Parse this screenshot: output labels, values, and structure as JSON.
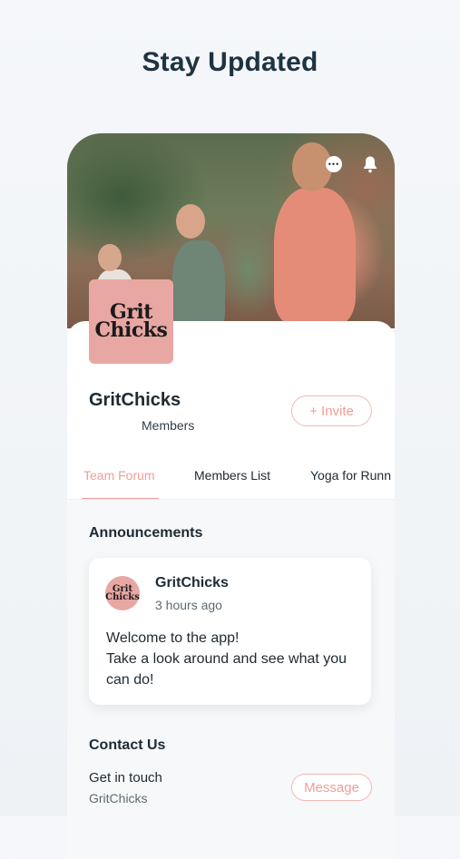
{
  "headline": "Stay Updated",
  "header_icons": {
    "chat": "chat-bubble-icon",
    "notifications": "bell-icon"
  },
  "group": {
    "logo_text_top": "Grit",
    "logo_text_bottom": "Chicks",
    "name": "GritChicks",
    "members_label": "Members",
    "invite_label": "+ Invite"
  },
  "tabs": [
    {
      "label": "Team Forum",
      "active": true
    },
    {
      "label": "Members List",
      "active": false
    },
    {
      "label": "Yoga for Runn",
      "active": false
    }
  ],
  "announcements": {
    "title": "Announcements",
    "post": {
      "author": "GritChicks",
      "time": "3 hours ago",
      "avatar_text_top": "Grit",
      "avatar_text_bottom": "Chicks",
      "body_lines": [
        "Welcome to the app!",
        "Take a look around and see what you",
        "can do!"
      ]
    }
  },
  "contact": {
    "title": "Contact Us",
    "label": "Get in touch",
    "sub": "GritChicks",
    "button_label": "Message"
  },
  "colors": {
    "accent": "#ec9f98",
    "brand_pink": "#e8a7a3",
    "text_dark": "#1e2a33"
  }
}
